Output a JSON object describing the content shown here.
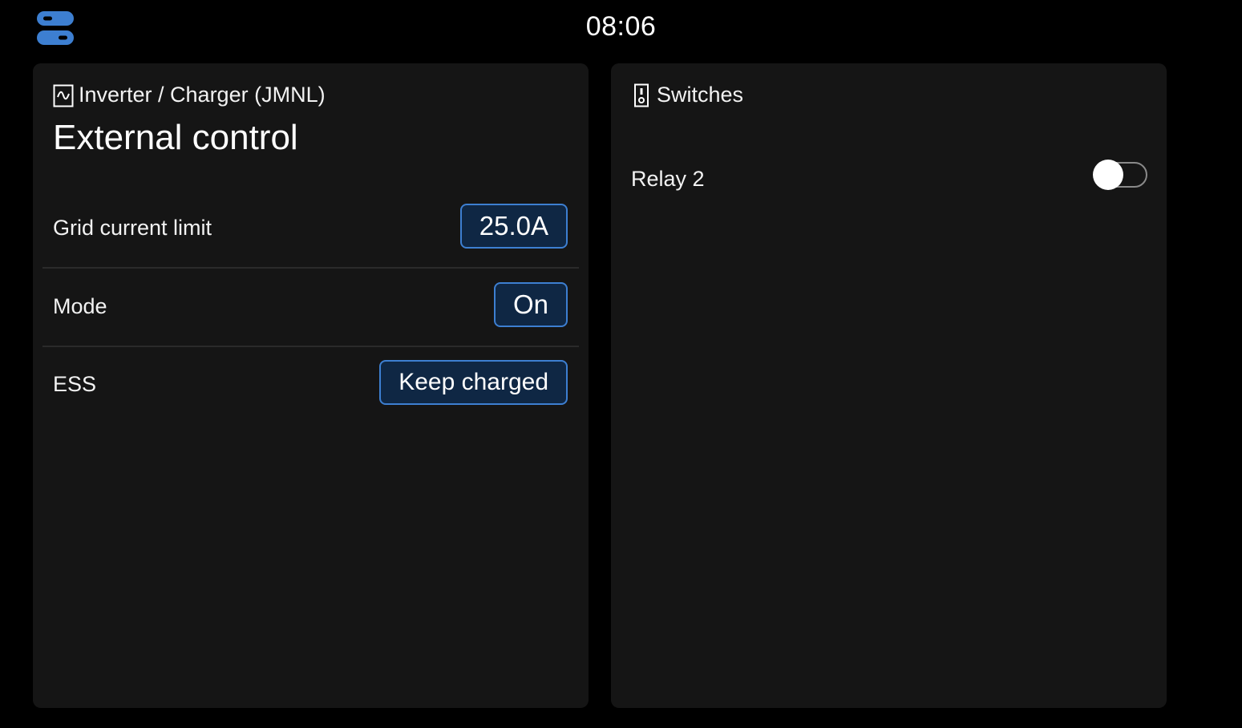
{
  "topbar": {
    "clock": "08:06",
    "controls_icon": "controls-toggle-icon",
    "accent_color": "#3d7fd1"
  },
  "inverter_panel": {
    "icon": "inverter-icon",
    "title": "Inverter / Charger (JMNL)",
    "subtitle": "External control",
    "rows": [
      {
        "label": "Grid current limit",
        "value": "25.0A"
      },
      {
        "label": "Mode",
        "value": "On"
      },
      {
        "label": "ESS",
        "value": "Keep charged"
      }
    ]
  },
  "switches_panel": {
    "icon": "switch-icon",
    "title": "Switches",
    "items": [
      {
        "label": "Relay 2",
        "state": "off"
      }
    ]
  }
}
